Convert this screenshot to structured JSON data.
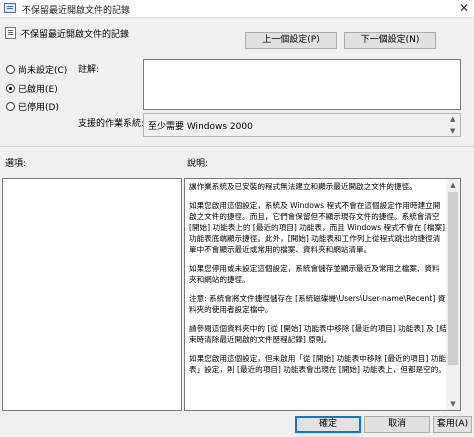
{
  "window": {
    "title": "不保留最近開啟文件的記錄",
    "close_glyph": "✕"
  },
  "policy": {
    "name": "不保留最近開啟文件的記錄"
  },
  "nav": {
    "prev_label": "上一個設定(P)",
    "next_label": "下一個設定(N)"
  },
  "state_options": [
    {
      "label": "尚未設定(C)",
      "checked": false
    },
    {
      "label": "已啟用(E)",
      "checked": true
    },
    {
      "label": "已停用(D)",
      "checked": false
    }
  ],
  "comment": {
    "label": "註解:",
    "value": ""
  },
  "supported": {
    "label": "支援的作業系統:",
    "value": "至少需要 Windows 2000"
  },
  "options": {
    "label": "選項:"
  },
  "help": {
    "label": "說明:",
    "paragraphs": [
      "讓作業系統及已安裝的程式無法建立和顯示最近開啟之文件的捷徑。",
      "如果您啟用這個設定，系統及 Windows 程式不會在這個設定作用時建立開啟之文件的捷徑。而且，它們會保留但不顯示現存文件的捷徑。系統會清空 [開始] 功能表上的 [最近的項目] 功能表，而且 Windows 程式不會在 [檔案] 功能表底端顯示捷徑。此外，[開始] 功能表和工作列上從程式跳出的捷徑清單中不會顯示最近或常用的檔案、資料夾和網站清單。",
      "如果您停用或未設定這個設定，系統會儲存並顯示最近及常用之檔案、資料夾和網站的捷徑。",
      "注意: 系統會將文件捷徑儲存在 [系統磁碟機\\Users\\User-name\\Recent] 資料夾的使用者設定檔中。",
      "請參閱這個資料夾中的 [從 [開始] 功能表中移除 [最近的項目] 功能表] 及 [結束時清除最近開啟的文件歷程記錄] 原則。",
      "如果您啟用這個設定，但未啟用「從 [開始] 功能表中移除 [最近的項目] 功能表」設定，則 [最近的項目] 功能表會出現在 [開始] 功能表上，但都是空的。"
    ]
  },
  "footer": {
    "ok_label": "確定",
    "cancel_label": "取消",
    "apply_label": "套用(A)"
  },
  "icons": {
    "up": "▲",
    "down": "▼"
  },
  "colors": {
    "accent": "#0078d7",
    "window_bg": "#f0f0f0"
  }
}
